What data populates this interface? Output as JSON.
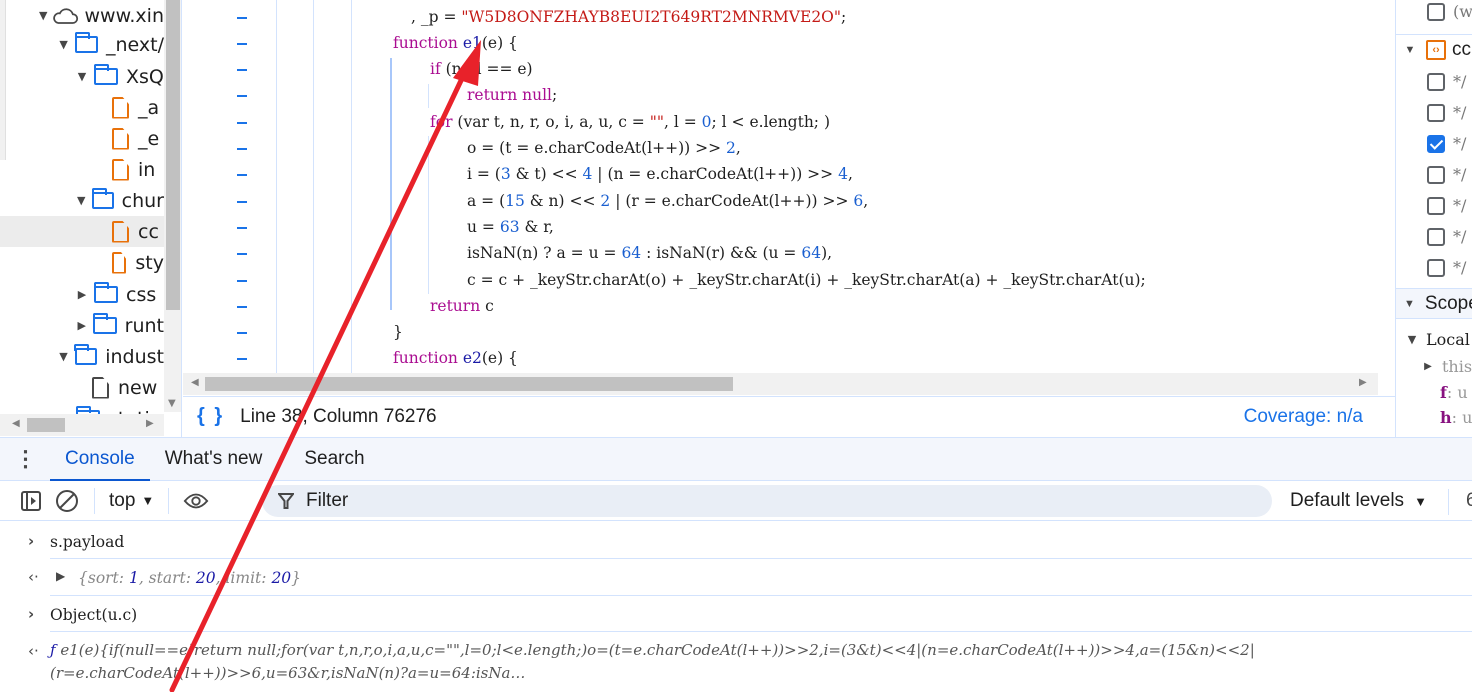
{
  "file_tree": {
    "items": [
      {
        "label": "www.xin",
        "type": "domain",
        "expanded": true
      },
      {
        "label": "_next/",
        "type": "folder",
        "expanded": true
      },
      {
        "label": "XsQ",
        "type": "folder",
        "expanded": true
      },
      {
        "label": "_a",
        "type": "file-script"
      },
      {
        "label": "_e",
        "type": "file-script"
      },
      {
        "label": "in",
        "type": "file-script"
      },
      {
        "label": "chur",
        "type": "folder",
        "expanded": true
      },
      {
        "label": "cc",
        "type": "file-script",
        "selected": true
      },
      {
        "label": "sty",
        "type": "file-script"
      },
      {
        "label": "css",
        "type": "folder",
        "expanded": false
      },
      {
        "label": "runt",
        "type": "folder",
        "expanded": false
      },
      {
        "label": "indust",
        "type": "folder",
        "expanded": true
      },
      {
        "label": "new",
        "type": "file-document"
      },
      {
        "label": "stati",
        "type": "folder",
        "expanded": false
      }
    ]
  },
  "editor": {
    "lines": [
      {
        "html_parts": [
          [
            "id",
            ", "
          ],
          [
            "id",
            "_p = "
          ],
          [
            "str",
            "\"W5D8ONFZHAYB8EUI2T649RT2MNRMVE2O\""
          ],
          [
            "id",
            ";"
          ]
        ]
      },
      {
        "html_parts": [
          [
            "kw",
            "function "
          ],
          [
            "fn",
            "e1"
          ],
          [
            "id",
            "(e) {"
          ]
        ]
      },
      {
        "html_parts": [
          [
            "kw",
            "if "
          ],
          [
            "id",
            "(null == e)"
          ]
        ]
      },
      {
        "html_parts": [
          [
            "kw",
            "return "
          ],
          [
            "kw",
            "null"
          ],
          [
            "id",
            ";"
          ]
        ]
      },
      {
        "html_parts": [
          [
            "kw",
            "for "
          ],
          [
            "id",
            "(var t, n, r, o, i, a, u, c = "
          ],
          [
            "str",
            "\"\""
          ],
          [
            "id",
            ", l = "
          ],
          [
            "num",
            "0"
          ],
          [
            "id",
            "; l < e.length; )"
          ]
        ]
      },
      {
        "html_parts": [
          [
            "id",
            "o = (t = e.charCodeAt(l++)) >> "
          ],
          [
            "num",
            "2"
          ],
          [
            "id",
            ","
          ]
        ]
      },
      {
        "html_parts": [
          [
            "id",
            "i = ("
          ],
          [
            "num",
            "3"
          ],
          [
            "id",
            " & t) << "
          ],
          [
            "num",
            "4"
          ],
          [
            "id",
            " | (n = e.charCodeAt(l++)) >> "
          ],
          [
            "num",
            "4"
          ],
          [
            "id",
            ","
          ]
        ]
      },
      {
        "html_parts": [
          [
            "id",
            "a = ("
          ],
          [
            "num",
            "15"
          ],
          [
            "id",
            " & n) << "
          ],
          [
            "num",
            "2"
          ],
          [
            "id",
            " | (r = e.charCodeAt(l++)) >> "
          ],
          [
            "num",
            "6"
          ],
          [
            "id",
            ","
          ]
        ]
      },
      {
        "html_parts": [
          [
            "id",
            "u = "
          ],
          [
            "num",
            "63"
          ],
          [
            "id",
            " & r,"
          ]
        ]
      },
      {
        "html_parts": [
          [
            "id",
            "isNaN(n) ? a = u = "
          ],
          [
            "num",
            "64"
          ],
          [
            "id",
            " : isNaN(r) && (u = "
          ],
          [
            "num",
            "64"
          ],
          [
            "id",
            "),"
          ]
        ]
      },
      {
        "html_parts": [
          [
            "id",
            "c = c + _keyStr.charAt(o) + _keyStr.charAt(i) + _keyStr.charAt(a) + _keyStr.charAt(u);"
          ]
        ]
      },
      {
        "html_parts": [
          [
            "kw",
            "return "
          ],
          [
            "id",
            "c"
          ]
        ]
      },
      {
        "html_parts": [
          [
            "id",
            "}"
          ]
        ]
      },
      {
        "html_parts": [
          [
            "kw",
            "function "
          ],
          [
            "fn",
            "e2"
          ],
          [
            "id",
            "(e) {"
          ]
        ]
      }
    ]
  },
  "status_bar": {
    "pretty_print_icon": "{ }",
    "position": "Line 38, Column 76276",
    "coverage": "Coverage: n/a"
  },
  "right_panel": {
    "top_item": "(w",
    "source_header": "cc",
    "breakpoints": [
      {
        "label": "*/",
        "checked": false
      },
      {
        "label": "*/",
        "checked": false
      },
      {
        "label": "*/",
        "checked": true
      },
      {
        "label": "*/",
        "checked": false
      },
      {
        "label": "*/",
        "checked": false
      },
      {
        "label": "*/",
        "checked": false
      },
      {
        "label": "*/",
        "checked": false
      }
    ],
    "scope_header": "Scope",
    "local_header": "Local",
    "vars": [
      {
        "name": "this",
        "value": ""
      },
      {
        "name": "f",
        "value": ": u"
      },
      {
        "name": "h",
        "value": ": u"
      }
    ]
  },
  "drawer": {
    "tabs": [
      {
        "label": "Console",
        "active": true
      },
      {
        "label": "What's new",
        "active": false
      },
      {
        "label": "Search",
        "active": false
      }
    ],
    "toolbar": {
      "context": "top",
      "filter_placeholder": "Filter",
      "levels": "Default levels",
      "issues": "6"
    }
  },
  "console": {
    "messages": [
      {
        "type": "input",
        "text": "s.payload"
      },
      {
        "type": "output-object",
        "preview": [
          "{sort: ",
          "1",
          ", start: ",
          "20",
          ", limit: ",
          "20",
          "}"
        ]
      },
      {
        "type": "input",
        "text": "Object(u.c)"
      },
      {
        "type": "output-function",
        "line1": " e1(e){if(null==e)return null;for(var t,n,r,o,i,a,u,c=\"\",l=0;l<e.length;)o=(t=e.charCodeAt(l++))>>2,i=(3&t)<<4|(n=e.charCodeAt(l++))>>4,a=(15&n)<<2|",
        "line2": "(r=e.charCodeAt(l++))>>6,u=63&r,isNaN(n)?a=u=64:isNa…",
        "prefix": "ƒ"
      }
    ]
  },
  "colors": {
    "accent": "#1a73e8",
    "annotation": "#e8222a"
  }
}
